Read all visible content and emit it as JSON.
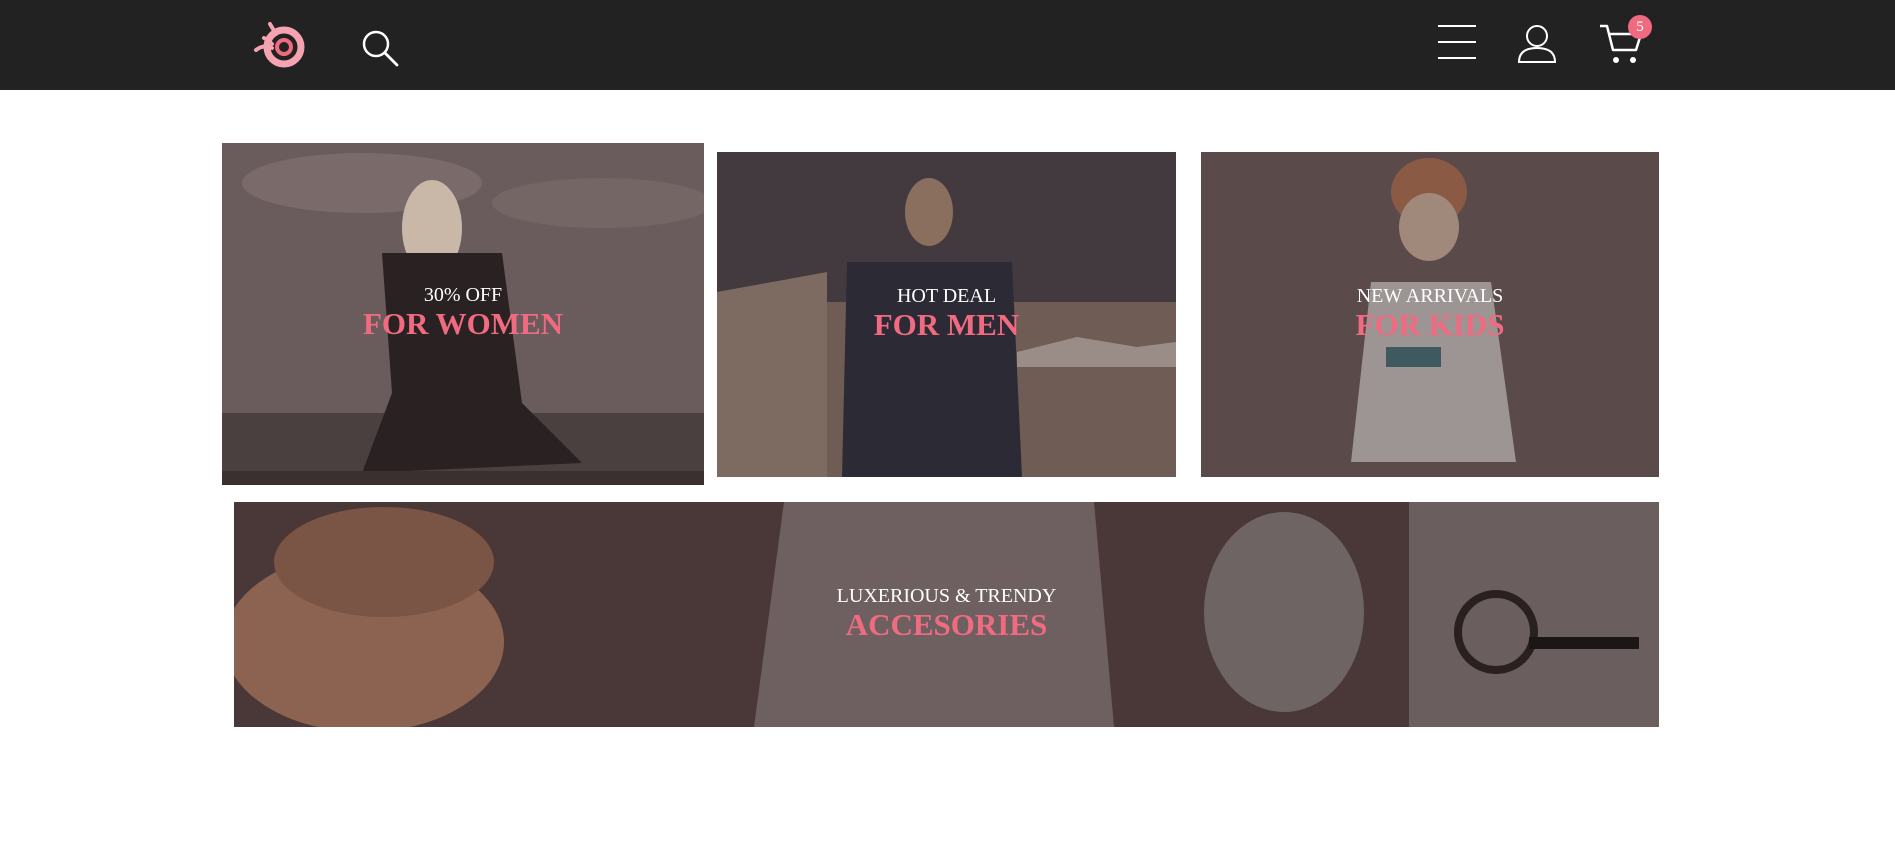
{
  "header": {
    "cart_count": "5",
    "icons": [
      "logo-icon",
      "search-icon",
      "menu-icon",
      "user-icon",
      "cart-icon"
    ]
  },
  "colors": {
    "header_bg": "#222222",
    "accent": "#f16b80",
    "overlay": "#5a4a4a"
  },
  "banners": {
    "women": {
      "subtitle": "30% OFF",
      "title": "FOR WOMEN"
    },
    "men": {
      "subtitle": "HOT DEAL",
      "title": "FOR MEN"
    },
    "kids": {
      "subtitle": "NEW ARRIVALS",
      "title": "FOR KIDS"
    },
    "accessories": {
      "subtitle": "LUXERIOUS & TRENDY",
      "title": "ACCESORIES"
    }
  }
}
